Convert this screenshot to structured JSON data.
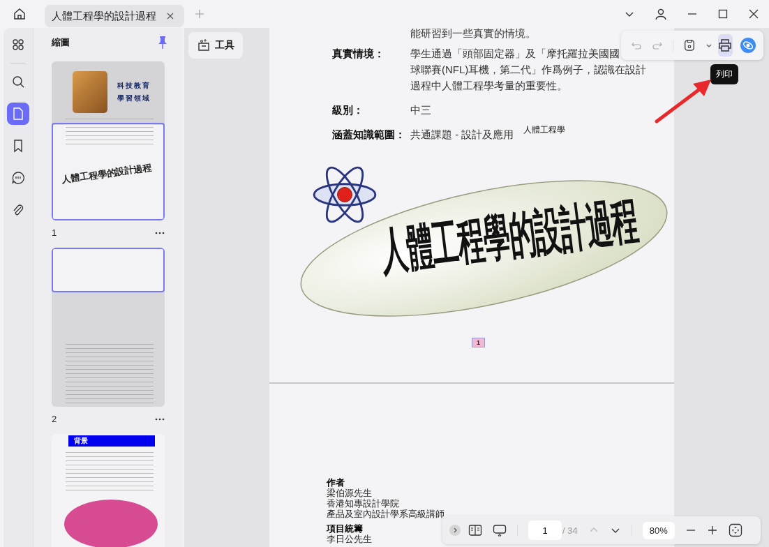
{
  "tabs": [
    {
      "label": "人體工程學的設計過程",
      "selected": true
    }
  ],
  "rail": [
    {
      "kind": "grid",
      "selected": false
    },
    {
      "kind": "search",
      "selected": false
    },
    {
      "kind": "page",
      "selected": true
    },
    {
      "kind": "bookmark",
      "selected": false
    },
    {
      "kind": "comment",
      "selected": false
    },
    {
      "kind": "attachment",
      "selected": false
    }
  ],
  "thumbnails_panel": {
    "title": "縮圖",
    "thumbnails": [
      {
        "page": "1",
        "kind": "cover",
        "heading": [
          "科技教育",
          "學習領域"
        ],
        "title": "人體工程學的設計過程"
      },
      {
        "page": "2",
        "kind": "text"
      },
      {
        "kind": "bubble",
        "heading": [
          "背景"
        ]
      }
    ]
  },
  "tools_button": "工具",
  "document": {
    "intro_line": "能研習到一些真實的情境。",
    "fields": [
      {
        "label": "真實情境：",
        "lines": [
          "學生通過「頭部固定器」及「摩托羅拉美國國",
          "球聯賽(NFL)耳機，第二代」作爲例子，認識在設計",
          "過程中人體工程學考量的重要性。"
        ]
      },
      {
        "label": "級別：",
        "value": "中三"
      },
      {
        "label": "涵蓋知識範圍：",
        "value": "共通課題 ‐ 設計及應用",
        "extra": "人體工程學"
      }
    ],
    "title_art": "人體工程學的設計過程",
    "page_badge": "1",
    "page2": [
      {
        "heading": "作者",
        "lines": [
          "梁伯源先生",
          "香港知專設計學院",
          "產品及室內設計學系高級講師"
        ]
      },
      {
        "heading": "項目統籌",
        "lines": [
          "李日公先生"
        ]
      }
    ]
  },
  "float_toolbar": {
    "tooltip": "列印"
  },
  "bottom_toolbar": {
    "page": "1",
    "total": "/ 34",
    "zoom": "80%"
  }
}
